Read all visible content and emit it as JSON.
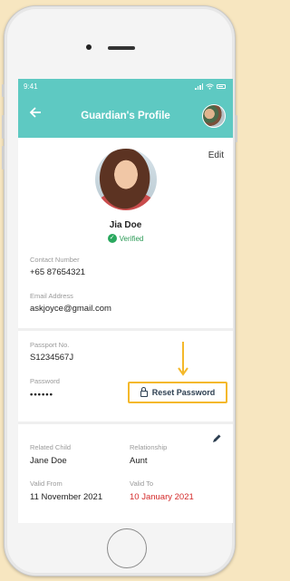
{
  "status": {
    "time": "9:41"
  },
  "appbar": {
    "title": "Guardian's Profile"
  },
  "profile": {
    "edit_label": "Edit",
    "name": "Jia Doe",
    "verified_label": "Verified"
  },
  "contact": {
    "contact_label": "Contact Number",
    "contact_value": "+65 87654321",
    "email_label": "Email Address",
    "email_value": "askjoyce@gmail.com"
  },
  "passport": {
    "passport_label": "Passport No.",
    "passport_value": "S1234567J",
    "password_label": "Password",
    "password_value": "••••••",
    "reset_label": "Reset Password"
  },
  "child": {
    "related_label": "Related Child",
    "related_value": "Jane Doe",
    "relationship_label": "Relationship",
    "relationship_value": "Aunt",
    "valid_from_label": "Valid From",
    "valid_from_value": "11 November 2021",
    "valid_to_label": "Valid To",
    "valid_to_value": "10 January 2021"
  },
  "colors": {
    "accent": "#5ec9c2",
    "highlight": "#f4b82a",
    "verified": "#2aa85e",
    "expired": "#d42a2a"
  },
  "icons": [
    "back-arrow-icon",
    "lock-icon",
    "pencil-icon",
    "check-icon",
    "signal-icon",
    "wifi-icon",
    "battery-icon",
    "down-arrow-icon"
  ]
}
